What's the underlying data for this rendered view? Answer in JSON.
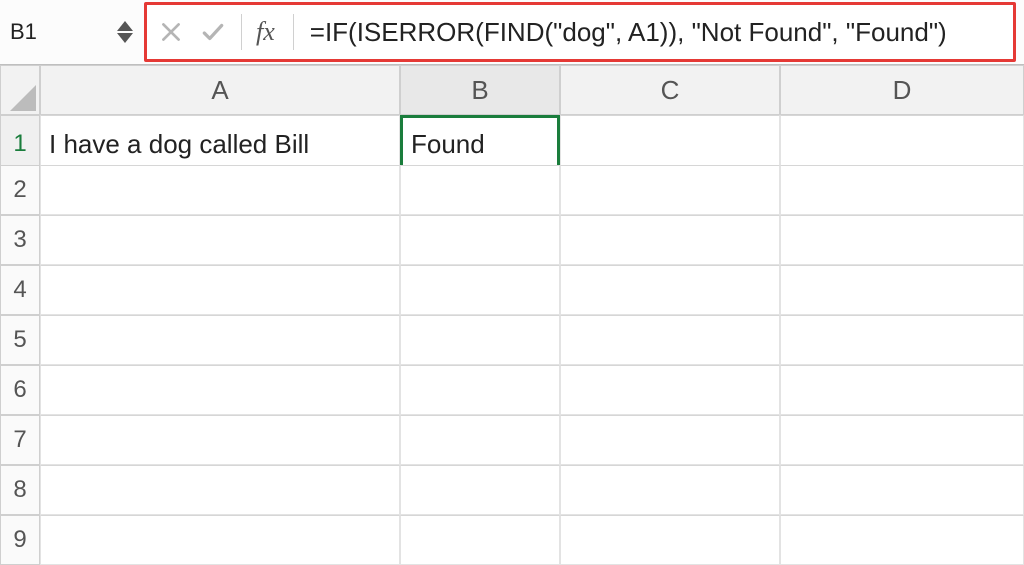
{
  "namebox": {
    "value": "B1"
  },
  "fx_label": "fx",
  "formula": "=IF(ISERROR(FIND(\"dog\", A1)), \"Not Found\", \"Found\")",
  "columns": [
    "A",
    "B",
    "C",
    "D"
  ],
  "rows": [
    "1",
    "2",
    "3",
    "4",
    "5",
    "6",
    "7",
    "8",
    "9"
  ],
  "cells": {
    "A1": "I have a dog called Bill",
    "B1": "Found"
  },
  "selected_cell": "B1",
  "colors": {
    "highlight_border": "#e53935",
    "selection_green": "#1a7d3c"
  }
}
